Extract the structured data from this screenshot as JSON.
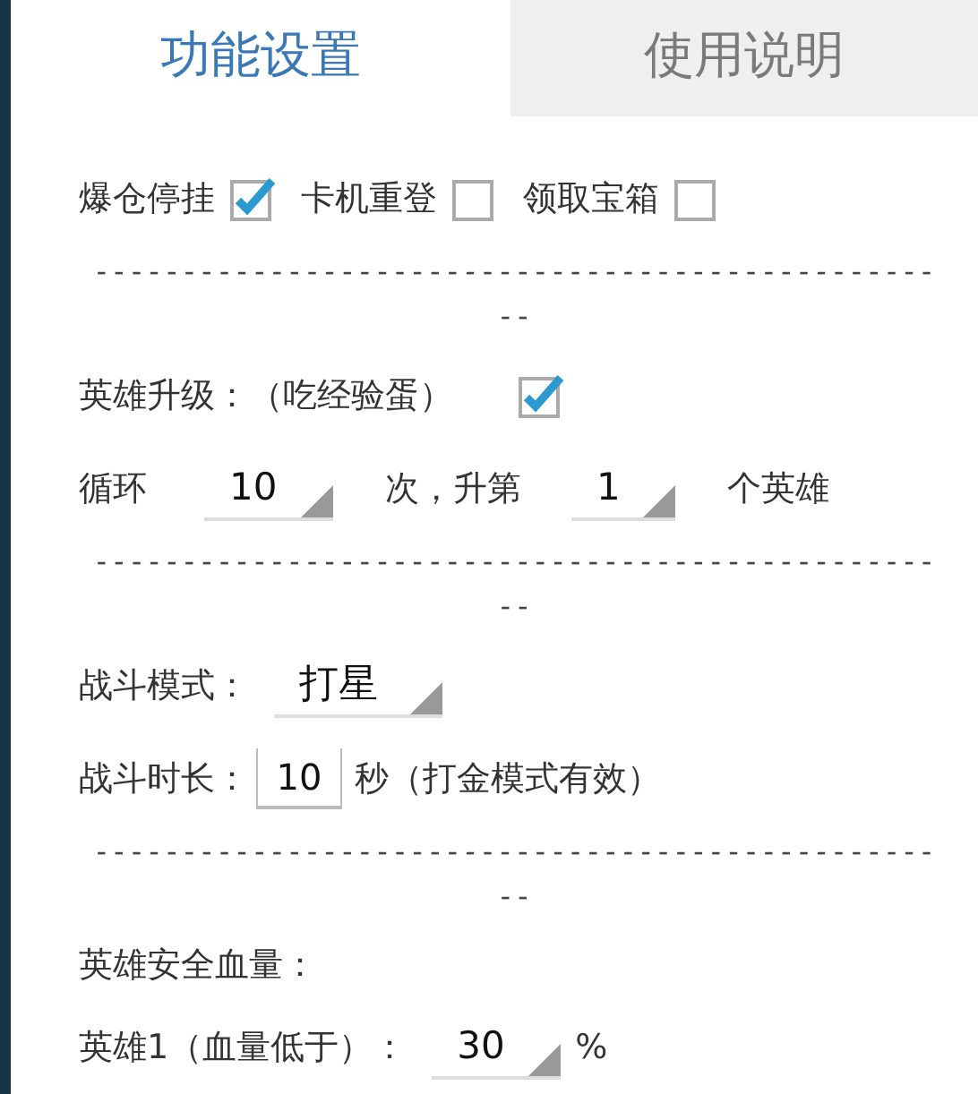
{
  "tabs": [
    {
      "label": "功能设置",
      "selected": true
    },
    {
      "label": "使用说明",
      "selected": false
    }
  ],
  "options": [
    {
      "label": "爆仓停挂",
      "checked": true
    },
    {
      "label": "卡机重登",
      "checked": false
    },
    {
      "label": "领取宝箱",
      "checked": false
    }
  ],
  "separator": {
    "line": "------------------------------------------------",
    "tail": "--"
  },
  "hero_upgrade": {
    "label": "英雄升级：（吃经验蛋）",
    "checked": true
  },
  "loop": {
    "prefix": "循环",
    "count": "10",
    "middle": "次，升第",
    "hero": "1",
    "suffix": "个英雄"
  },
  "battle_mode": {
    "label": "战斗模式：",
    "value": "打星"
  },
  "battle_duration": {
    "label": "战斗时长：",
    "value": "10",
    "suffix": "秒（打金模式有效）"
  },
  "safe_hp": {
    "title": "英雄安全血量："
  },
  "hero_hp": [
    {
      "label": "英雄1（血量低于）：",
      "value": "30",
      "suffix": "%"
    }
  ]
}
